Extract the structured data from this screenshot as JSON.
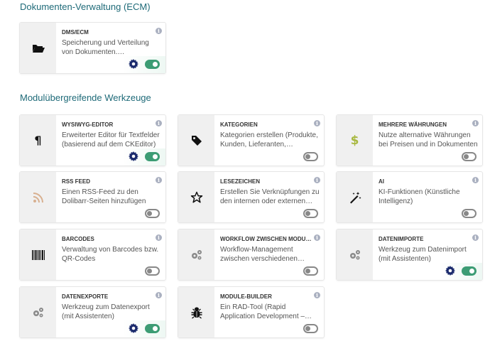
{
  "sections": [
    {
      "title": "Dokumenten-Verwaltung (ECM)",
      "cards": [
        {
          "title": "DMS/ECM",
          "desc": "Speicherung und Verteilung von Dokumenten. Automatische…",
          "icon": "folder-open-icon",
          "enabled": true,
          "has_settings": true
        }
      ]
    },
    {
      "title": "Modulübergreifende Werkzeuge",
      "cards": [
        {
          "title": "WYSIWYG-EDITOR",
          "desc": "Erweiterter Editor für Textfelder (basierend auf dem CKEditor)",
          "icon": "paragraph-icon",
          "enabled": true,
          "has_settings": true
        },
        {
          "title": "KATEGORIEN",
          "desc": "Kategorien erstellen (Produkte, Kunden, Lieferanten, Kontakte…",
          "icon": "tag-icon",
          "enabled": false,
          "has_settings": false
        },
        {
          "title": "MEHRERE WÄHRUNGEN",
          "desc": "Nutze alternative Währungen bei Preisen und in Dokumenten",
          "icon": "dollar-icon",
          "enabled": false,
          "has_settings": false
        },
        {
          "title": "RSS FEED",
          "desc": "Einen RSS-Feed zu den Dolibarr-Seiten hinzufügen",
          "icon": "rss-icon",
          "enabled": false,
          "has_settings": false
        },
        {
          "title": "LESEZEICHEN",
          "desc": "Erstellen Sie Verknüpfungen zu den internen oder externen…",
          "icon": "star-icon",
          "enabled": false,
          "has_settings": false
        },
        {
          "title": "AI",
          "desc": "KI-Funktionen (Künstliche Intelligenz)",
          "icon": "magic-wand-icon",
          "enabled": false,
          "has_settings": false
        },
        {
          "title": "BARCODES",
          "desc": "Verwaltung von Barcodes bzw. QR-Codes",
          "icon": "barcode-icon",
          "enabled": false,
          "has_settings": false
        },
        {
          "title": "WORKFLOW ZWISCHEN MODUL…",
          "desc": "Workflow-Management zwischen verschiedenen Modulen…",
          "icon": "cogs-icon",
          "enabled": false,
          "has_settings": false
        },
        {
          "title": "DATENIMPORTE",
          "desc": "Werkzeug zum Datenimport (mit Assistenten)",
          "icon": "cogs-icon",
          "enabled": true,
          "has_settings": true
        },
        {
          "title": "DATENEXPORTE",
          "desc": "Werkzeug zum Datenexport (mit Assistenten)",
          "icon": "cogs-icon",
          "enabled": true,
          "has_settings": true
        },
        {
          "title": "MODULE-BUILDER",
          "desc": "Ein RAD-Tool (Rapid Application Development – Low-Code und…",
          "icon": "bug-icon",
          "enabled": false,
          "has_settings": false
        }
      ]
    }
  ],
  "info_glyph": "i",
  "colors": {
    "accent": "#1e6a78",
    "toggle_on": "#3c9c74",
    "gear": "#1a2a6c"
  }
}
